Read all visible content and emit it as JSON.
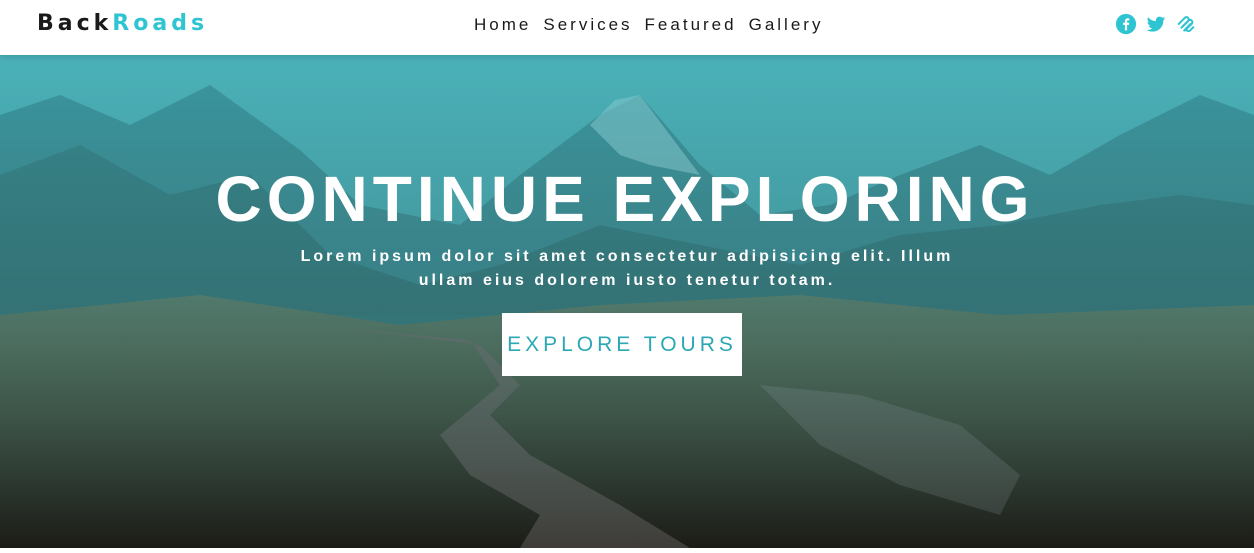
{
  "brand": {
    "logo_part1": "Back",
    "logo_part2": "Roads",
    "accent_color": "#2fc4d1",
    "dark_color": "#1a1a1a"
  },
  "nav": {
    "links": [
      "Home",
      "Services",
      "Featured",
      "Gallery"
    ]
  },
  "social": {
    "icons": [
      "facebook-icon",
      "twitter-icon",
      "squarespace-icon"
    ]
  },
  "hero": {
    "title": "CONTINUE EXPLORING",
    "subtitle_line1": "Lorem ipsum dolor sit amet consectetur adipisicing elit. Illum",
    "subtitle_line2": "ullam eius dolorem iusto tenetur totam.",
    "cta_label": "EXPLORE TOURS",
    "overlay_color": "#2fc4d1"
  }
}
